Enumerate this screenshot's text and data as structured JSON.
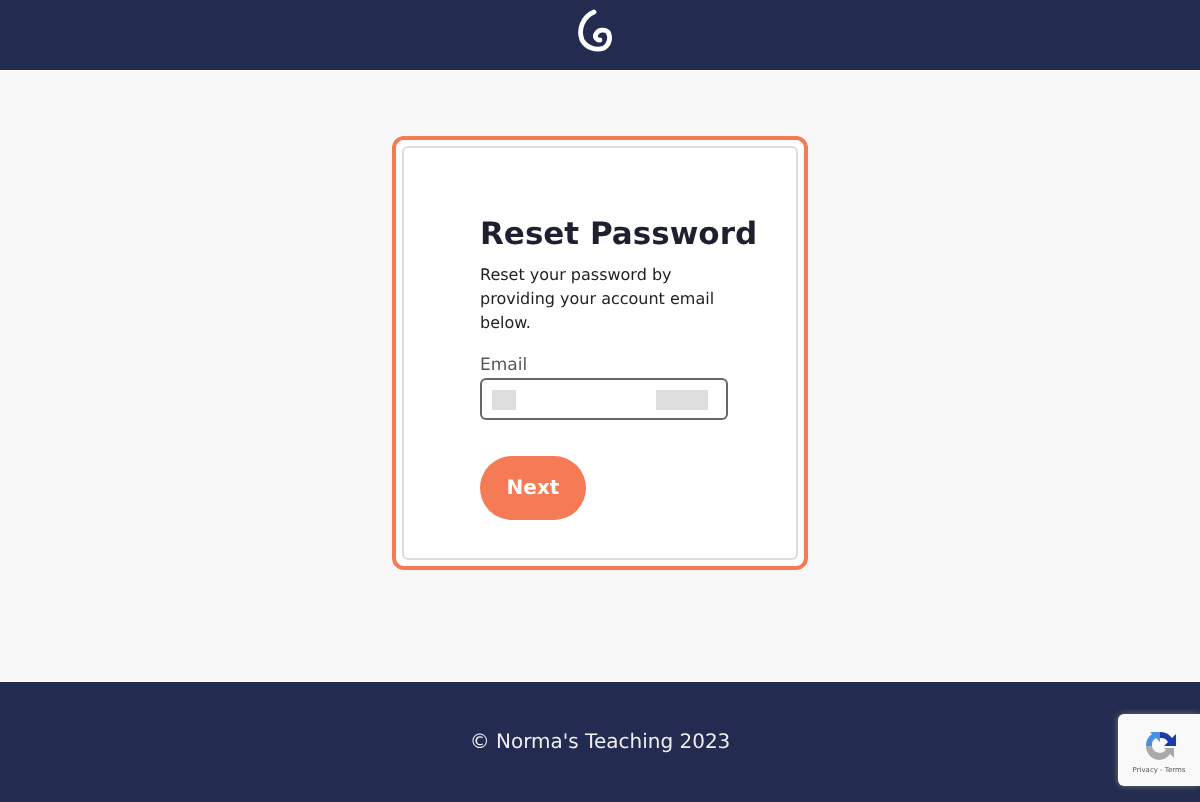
{
  "form": {
    "title": "Reset Password",
    "description": "Reset your password by providing your account email below.",
    "email_label": "Email",
    "button": "Next"
  },
  "footer": {
    "copyright": "© Norma's Teaching 2023"
  },
  "recaptcha": {
    "links": "Privacy - Terms"
  }
}
